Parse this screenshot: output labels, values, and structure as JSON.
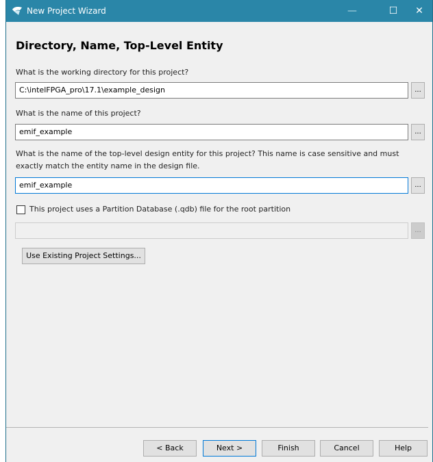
{
  "window": {
    "title": "New Project Wizard",
    "minimize_icon": "—",
    "maximize_icon": "☐",
    "close_icon": "✕"
  },
  "page": {
    "title": "Directory, Name, Top-Level Entity"
  },
  "directory": {
    "label": "What is the working directory for this project?",
    "value": "C:\\intelFPGA_pro\\17.1\\example_design",
    "browse_label": "..."
  },
  "project_name": {
    "label": "What is the name of this project?",
    "value": "emif_example",
    "browse_label": "..."
  },
  "top_level": {
    "label_line1": "What is the name of the top-level design entity for this project? This name is case sensitive and must",
    "label_line2": "exactly match the entity name in the design file.",
    "value": "emif_example",
    "browse_label": "..."
  },
  "partition": {
    "checkbox_label": "This project uses a Partition Database (.qdb) file for the root partition",
    "checked": false,
    "value": "",
    "browse_label": "..."
  },
  "use_existing_label": "Use Existing Project Settings...",
  "footer": {
    "back": "< Back",
    "next": "Next >",
    "finish": "Finish",
    "cancel": "Cancel",
    "help": "Help"
  },
  "colors": {
    "titlebar": "#2a86a8",
    "focus_border": "#0078d7",
    "dialog_bg": "#f0f0f0"
  }
}
